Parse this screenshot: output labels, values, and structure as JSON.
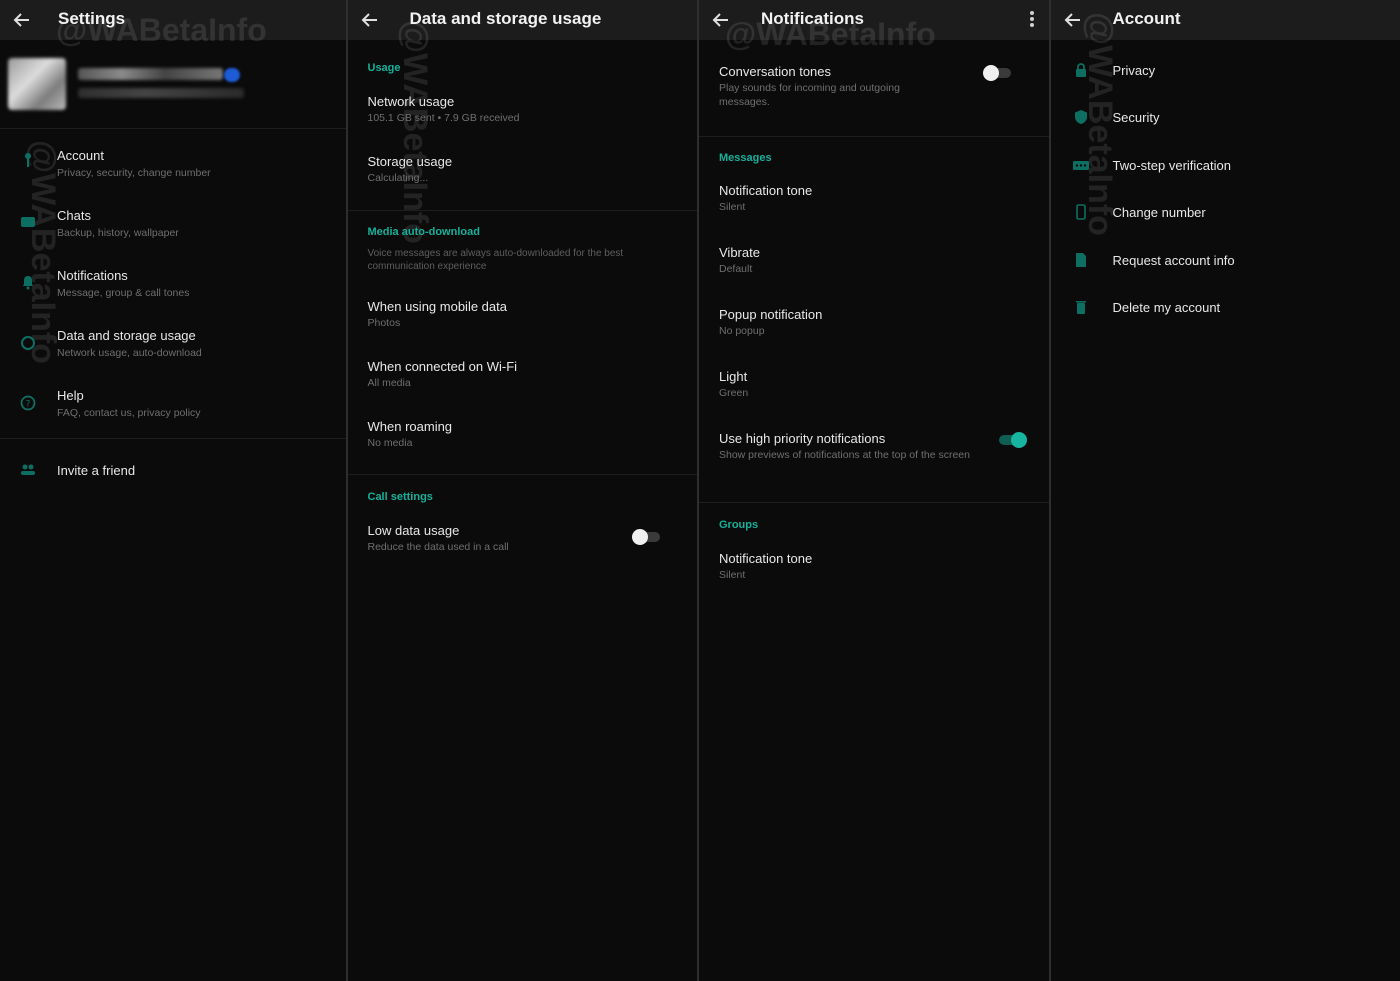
{
  "watermark": "@WABetaInfo",
  "colors": {
    "accent": "#15b09b",
    "background": "#0b0b0b",
    "appbar": "#1c1c1c",
    "subtext": "#6f6f6f"
  },
  "settings": {
    "title": "Settings",
    "items": [
      {
        "title": "Account",
        "subtitle": "Privacy, security, change number",
        "icon": "key-icon"
      },
      {
        "title": "Chats",
        "subtitle": "Backup, history, wallpaper",
        "icon": "chat-icon"
      },
      {
        "title": "Notifications",
        "subtitle": "Message, group & call tones",
        "icon": "bell-icon"
      },
      {
        "title": "Data and storage usage",
        "subtitle": "Network usage, auto-download",
        "icon": "data-usage-icon"
      },
      {
        "title": "Help",
        "subtitle": "FAQ, contact us, privacy policy",
        "icon": "help-icon"
      }
    ],
    "invite": {
      "title": "Invite a friend",
      "icon": "people-icon"
    }
  },
  "data_storage": {
    "title": "Data and storage usage",
    "usage_header": "Usage",
    "network_usage": {
      "title": "Network usage",
      "subtitle": "105.1 GB sent • 7.9 GB received"
    },
    "storage_usage": {
      "title": "Storage usage",
      "subtitle": "Calculating..."
    },
    "media_header": "Media auto-download",
    "media_desc": "Voice messages are always auto-downloaded for the best communication experience",
    "mobile_data": {
      "title": "When using mobile data",
      "subtitle": "Photos"
    },
    "wifi": {
      "title": "When connected on Wi-Fi",
      "subtitle": "All media"
    },
    "roaming": {
      "title": "When roaming",
      "subtitle": "No media"
    },
    "call_header": "Call settings",
    "low_data": {
      "title": "Low data usage",
      "subtitle": "Reduce the data used in a call",
      "enabled": false
    }
  },
  "notifications": {
    "title": "Notifications",
    "conversation_tones": {
      "title": "Conversation tones",
      "subtitle": "Play sounds for incoming and outgoing messages.",
      "enabled": false
    },
    "messages_header": "Messages",
    "msg_tone": {
      "title": "Notification tone",
      "subtitle": "Silent"
    },
    "vibrate": {
      "title": "Vibrate",
      "subtitle": "Default"
    },
    "popup": {
      "title": "Popup notification",
      "subtitle": "No popup"
    },
    "light": {
      "title": "Light",
      "subtitle": "Green"
    },
    "high_priority": {
      "title": "Use high priority notifications",
      "subtitle": "Show previews of notifications at the top of the screen",
      "enabled": true
    },
    "groups_header": "Groups",
    "group_tone": {
      "title": "Notification tone",
      "subtitle": "Silent"
    }
  },
  "account": {
    "title": "Account",
    "items": [
      {
        "title": "Privacy",
        "icon": "lock-icon"
      },
      {
        "title": "Security",
        "icon": "shield-icon"
      },
      {
        "title": "Two-step verification",
        "icon": "dots-password-icon"
      },
      {
        "title": "Change number",
        "icon": "phone-icon"
      },
      {
        "title": "Request account info",
        "icon": "document-icon"
      },
      {
        "title": "Delete my account",
        "icon": "trash-icon"
      }
    ]
  }
}
